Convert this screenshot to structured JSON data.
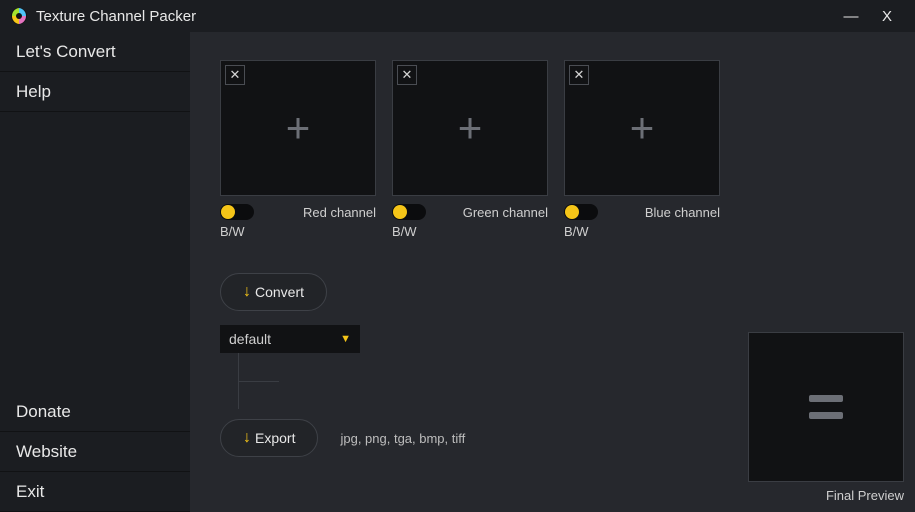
{
  "titlebar": {
    "title": "Texture Channel Packer"
  },
  "sidebar": {
    "items": [
      {
        "label": "Let's Convert"
      },
      {
        "label": "Help"
      },
      {
        "label": "Donate"
      },
      {
        "label": "Website"
      },
      {
        "label": "Exit"
      }
    ]
  },
  "slots": [
    {
      "channel_label": "Red channel",
      "bw_label": "B/W"
    },
    {
      "channel_label": "Green channel",
      "bw_label": "B/W"
    },
    {
      "channel_label": "Blue channel",
      "bw_label": "B/W"
    }
  ],
  "buttons": {
    "convert": "Convert",
    "export": "Export"
  },
  "select": {
    "value": "default"
  },
  "export_formats": "jpg, png, tga, bmp, tiff",
  "preview": {
    "label": "Final Preview"
  }
}
